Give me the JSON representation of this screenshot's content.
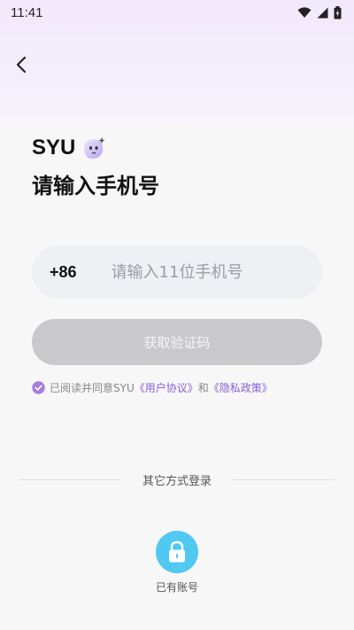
{
  "status_bar": {
    "time": "11:41"
  },
  "header": {
    "back_icon": "back-arrow-icon"
  },
  "brand": {
    "name": "SYU",
    "mascot_icon": "mascot-icon"
  },
  "page": {
    "title": "请输入手机号"
  },
  "phone_form": {
    "country_code": "+86",
    "placeholder": "请输入11位手机号",
    "value": "",
    "clear_icon": "clear-icon"
  },
  "get_code_button": {
    "label": "获取验证码"
  },
  "agreement": {
    "checked": true,
    "prefix": "已阅读并同意SYU",
    "user_agreement": "《用户协议》",
    "conjunction": "和",
    "privacy_policy": "《隐私政策》"
  },
  "other_login": {
    "label": "其它方式登录",
    "account_login_label": "已有账号",
    "account_icon": "lock-icon"
  },
  "colors": {
    "accent": "#8a5ed8",
    "button_disabled": "#c9c9cb",
    "account_icon_bg": "#4fc9f2",
    "field_bg": "#eef0f4"
  }
}
